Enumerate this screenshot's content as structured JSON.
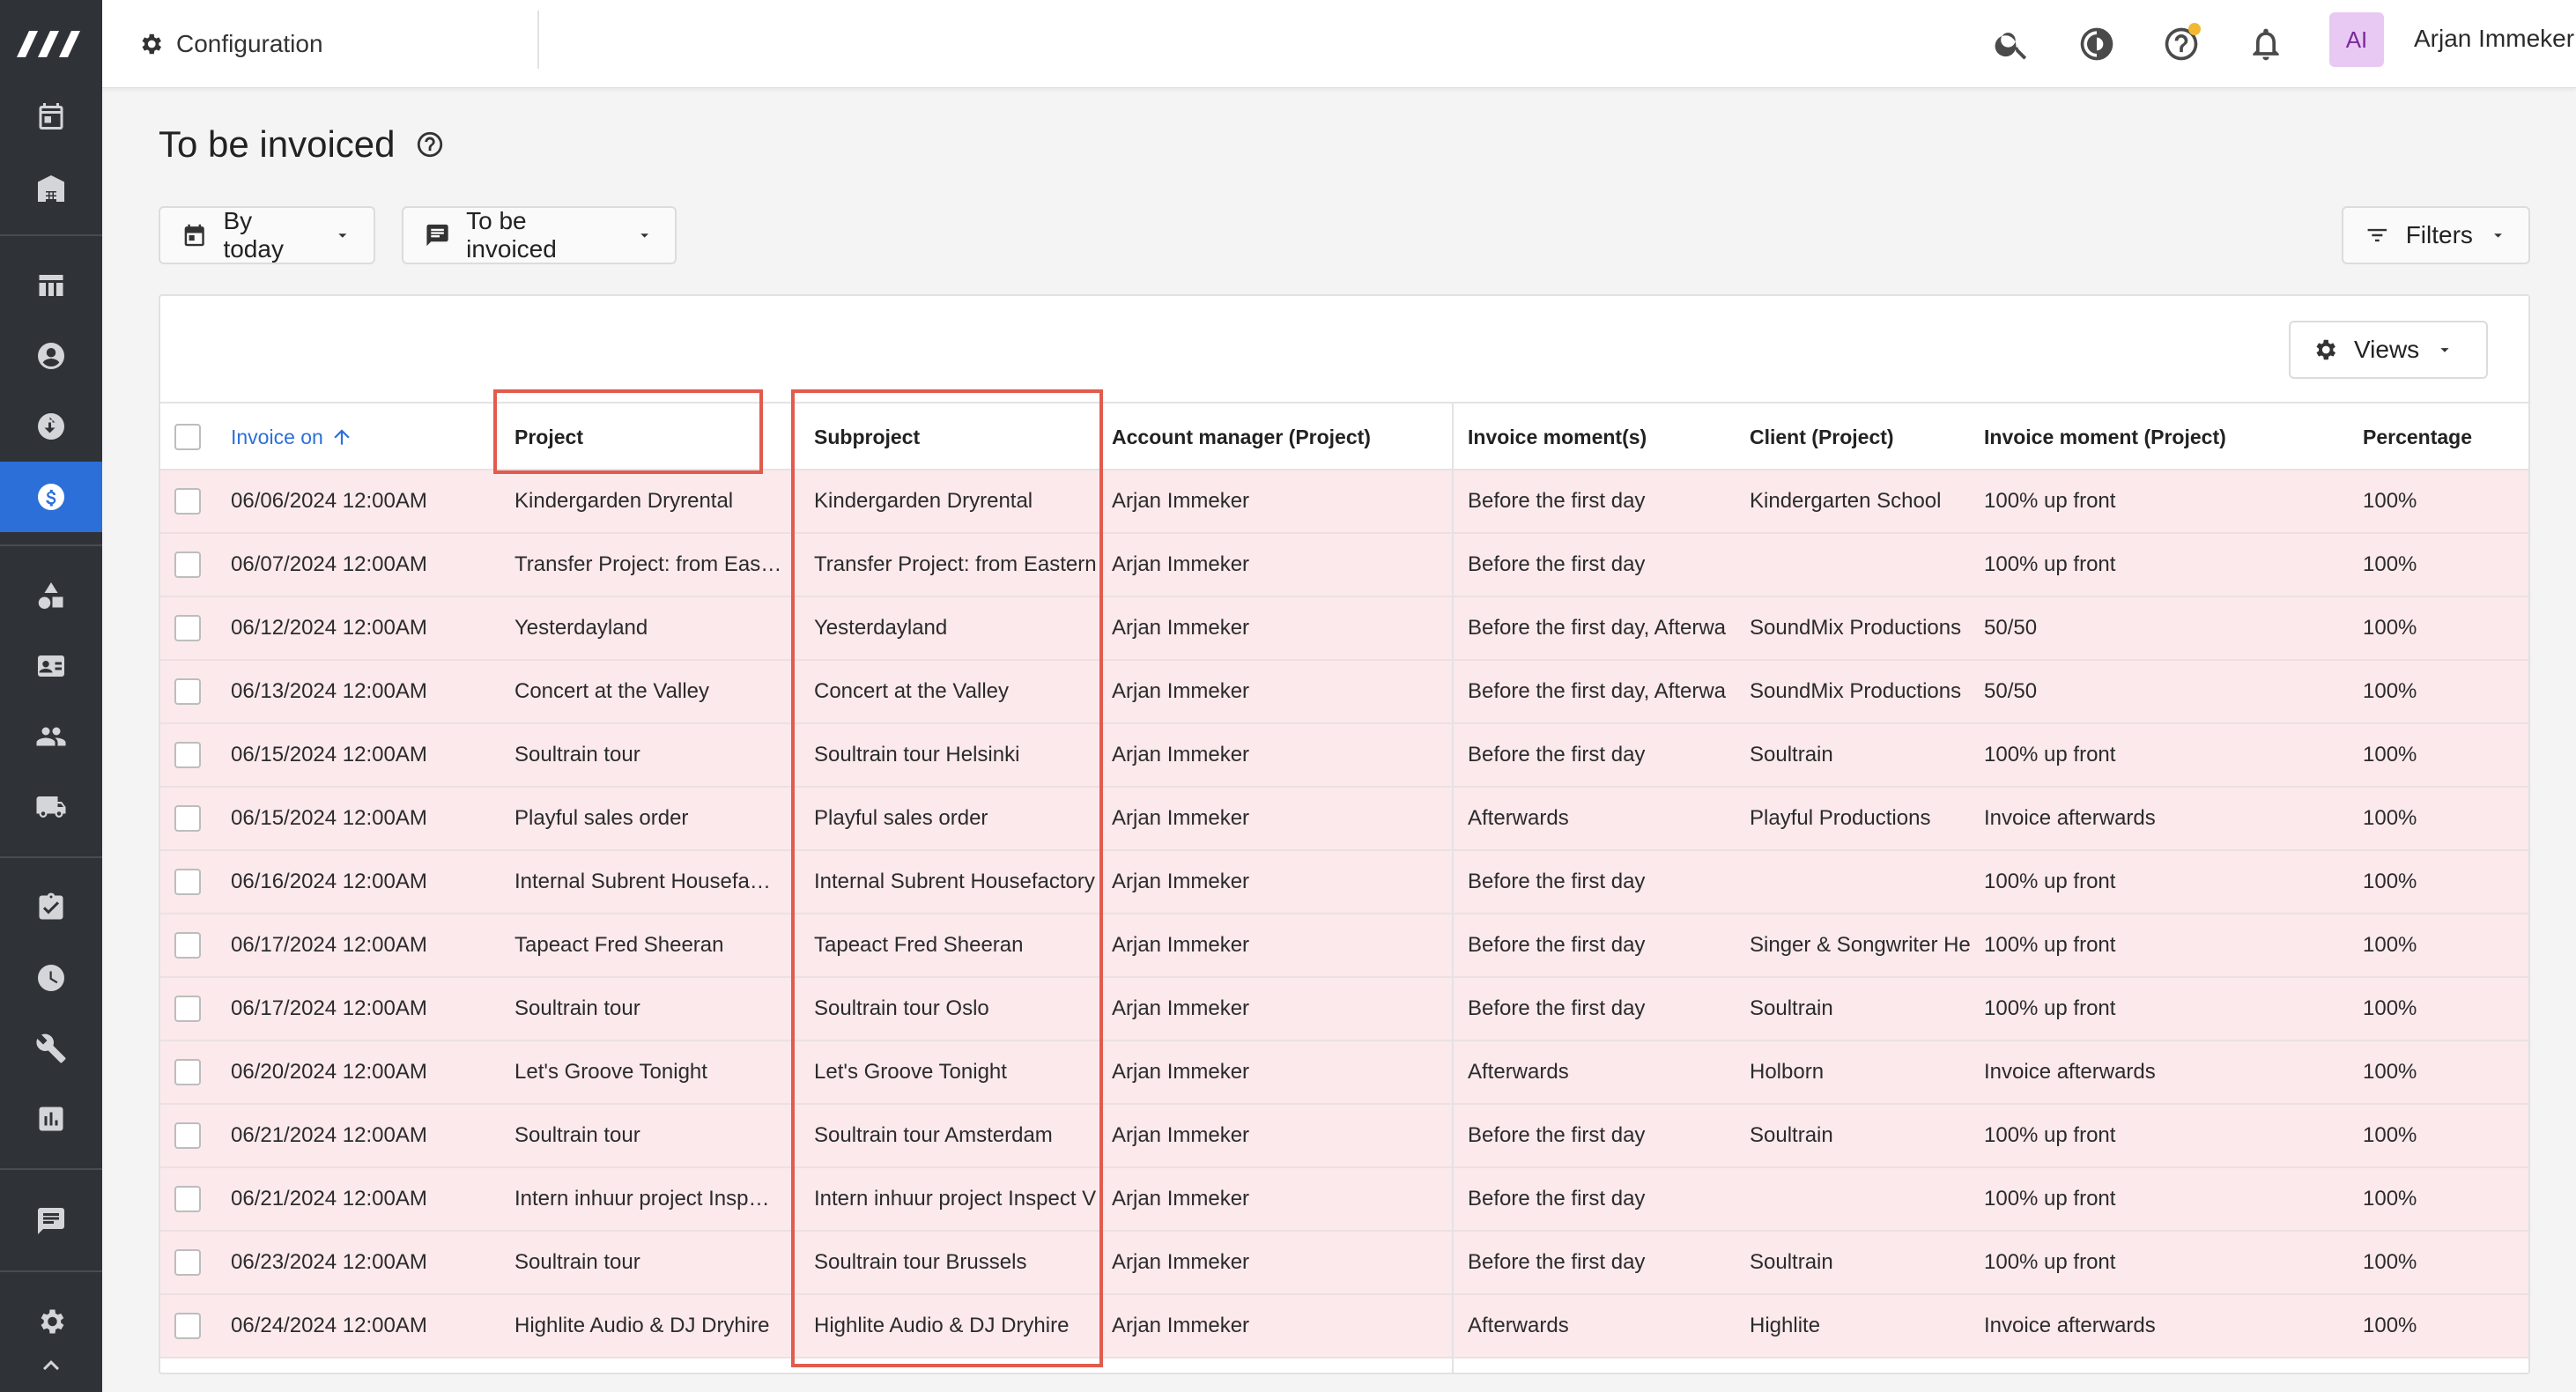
{
  "topbar": {
    "breadcrumb": "Configuration",
    "avatar_initials": "AI",
    "username": "Arjan Immeker"
  },
  "page": {
    "title": "To be invoiced"
  },
  "toolbar": {
    "date_filter": "By today",
    "status_filter": "To be invoiced",
    "filters": "Filters",
    "views": "Views"
  },
  "table": {
    "headers": {
      "invoice_on": "Invoice on",
      "project": "Project",
      "subproject": "Subproject",
      "account_manager": "Account manager (Project)",
      "invoice_moments": "Invoice moment(s)",
      "client": "Client (Project)",
      "invoice_moment_project": "Invoice moment (Project)",
      "percentage": "Percentage"
    },
    "rows": [
      {
        "invoice_on": "06/06/2024 12:00AM",
        "project": "Kindergarden Dryrental",
        "subproject": "Kindergarden Dryrental",
        "account_manager": "Arjan Immeker",
        "invoice_moments": "Before the first day",
        "client": "Kindergarten School",
        "invoice_moment_project": "100% up front",
        "percentage": "100%"
      },
      {
        "invoice_on": "06/07/2024 12:00AM",
        "project": "Transfer Project: from Eas…",
        "subproject": "Transfer Project: from Eastern",
        "account_manager": "Arjan Immeker",
        "invoice_moments": "Before the first day",
        "client": "",
        "invoice_moment_project": "100% up front",
        "percentage": "100%"
      },
      {
        "invoice_on": "06/12/2024 12:00AM",
        "project": "Yesterdayland",
        "subproject": "Yesterdayland",
        "account_manager": "Arjan Immeker",
        "invoice_moments": "Before the first day, Afterwa",
        "client": "SoundMix Productions",
        "invoice_moment_project": "50/50",
        "percentage": "100%"
      },
      {
        "invoice_on": "06/13/2024 12:00AM",
        "project": "Concert at the Valley",
        "subproject": "Concert at the Valley",
        "account_manager": "Arjan Immeker",
        "invoice_moments": "Before the first day, Afterwa",
        "client": "SoundMix Productions",
        "invoice_moment_project": "50/50",
        "percentage": "100%"
      },
      {
        "invoice_on": "06/15/2024 12:00AM",
        "project": "Soultrain tour",
        "subproject": "Soultrain tour Helsinki",
        "account_manager": "Arjan Immeker",
        "invoice_moments": "Before the first day",
        "client": "Soultrain",
        "invoice_moment_project": "100% up front",
        "percentage": "100%"
      },
      {
        "invoice_on": "06/15/2024 12:00AM",
        "project": "Playful sales order",
        "subproject": "Playful sales order",
        "account_manager": "Arjan Immeker",
        "invoice_moments": "Afterwards",
        "client": "Playful Productions",
        "invoice_moment_project": "Invoice afterwards",
        "percentage": "100%"
      },
      {
        "invoice_on": "06/16/2024 12:00AM",
        "project": "Internal Subrent Housefa…",
        "subproject": "Internal Subrent Housefactory",
        "account_manager": "Arjan Immeker",
        "invoice_moments": "Before the first day",
        "client": "",
        "invoice_moment_project": "100% up front",
        "percentage": "100%"
      },
      {
        "invoice_on": "06/17/2024 12:00AM",
        "project": "Tapeact Fred Sheeran",
        "subproject": "Tapeact Fred Sheeran",
        "account_manager": "Arjan Immeker",
        "invoice_moments": "Before the first day",
        "client": "Singer & Songwriter He",
        "invoice_moment_project": "100% up front",
        "percentage": "100%"
      },
      {
        "invoice_on": "06/17/2024 12:00AM",
        "project": "Soultrain tour",
        "subproject": "Soultrain tour Oslo",
        "account_manager": "Arjan Immeker",
        "invoice_moments": "Before the first day",
        "client": "Soultrain",
        "invoice_moment_project": "100% up front",
        "percentage": "100%"
      },
      {
        "invoice_on": "06/20/2024 12:00AM",
        "project": "Let's Groove Tonight",
        "subproject": "Let's Groove Tonight",
        "account_manager": "Arjan Immeker",
        "invoice_moments": "Afterwards",
        "client": "Holborn",
        "invoice_moment_project": "Invoice afterwards",
        "percentage": "100%"
      },
      {
        "invoice_on": "06/21/2024 12:00AM",
        "project": "Soultrain tour",
        "subproject": "Soultrain tour Amsterdam",
        "account_manager": "Arjan Immeker",
        "invoice_moments": "Before the first day",
        "client": "Soultrain",
        "invoice_moment_project": "100% up front",
        "percentage": "100%"
      },
      {
        "invoice_on": "06/21/2024 12:00AM",
        "project": "Intern inhuur project Insp…",
        "subproject": "Intern inhuur project Inspect V",
        "account_manager": "Arjan Immeker",
        "invoice_moments": "Before the first day",
        "client": "",
        "invoice_moment_project": "100% up front",
        "percentage": "100%"
      },
      {
        "invoice_on": "06/23/2024 12:00AM",
        "project": "Soultrain tour",
        "subproject": "Soultrain tour Brussels",
        "account_manager": "Arjan Immeker",
        "invoice_moments": "Before the first day",
        "client": "Soultrain",
        "invoice_moment_project": "100% up front",
        "percentage": "100%"
      },
      {
        "invoice_on": "06/24/2024 12:00AM",
        "project": "Highlite Audio & DJ Dryhire",
        "subproject": "Highlite Audio & DJ Dryhire",
        "account_manager": "Arjan Immeker",
        "invoice_moments": "Afterwards",
        "client": "Highlite",
        "invoice_moment_project": "Invoice afterwards",
        "percentage": "100%"
      }
    ]
  },
  "sidebar": {
    "items": [
      {
        "icon": "calendar-icon"
      },
      {
        "icon": "warehouse-icon"
      },
      {
        "icon": "table-icon"
      },
      {
        "icon": "contact-icon"
      },
      {
        "icon": "exchange-icon"
      },
      {
        "icon": "dollar-icon",
        "active": true
      },
      {
        "icon": "shapes-icon"
      },
      {
        "icon": "id-card-icon"
      },
      {
        "icon": "people-icon"
      },
      {
        "icon": "truck-icon"
      },
      {
        "icon": "clipboard-check-icon"
      },
      {
        "icon": "clock-icon"
      },
      {
        "icon": "wrench-icon"
      },
      {
        "icon": "chart-icon"
      },
      {
        "icon": "message-icon"
      },
      {
        "icon": "gear-icon"
      },
      {
        "icon": "chevron-up-icon"
      }
    ]
  },
  "colors": {
    "sidebar_bg": "#2f3237",
    "accent": "#2c6fd9",
    "row_bg": "#fbe9ec",
    "highlight": "#e25b4d",
    "avatar_bg": "#e8c9f3",
    "notification_dot": "#f3b832"
  }
}
